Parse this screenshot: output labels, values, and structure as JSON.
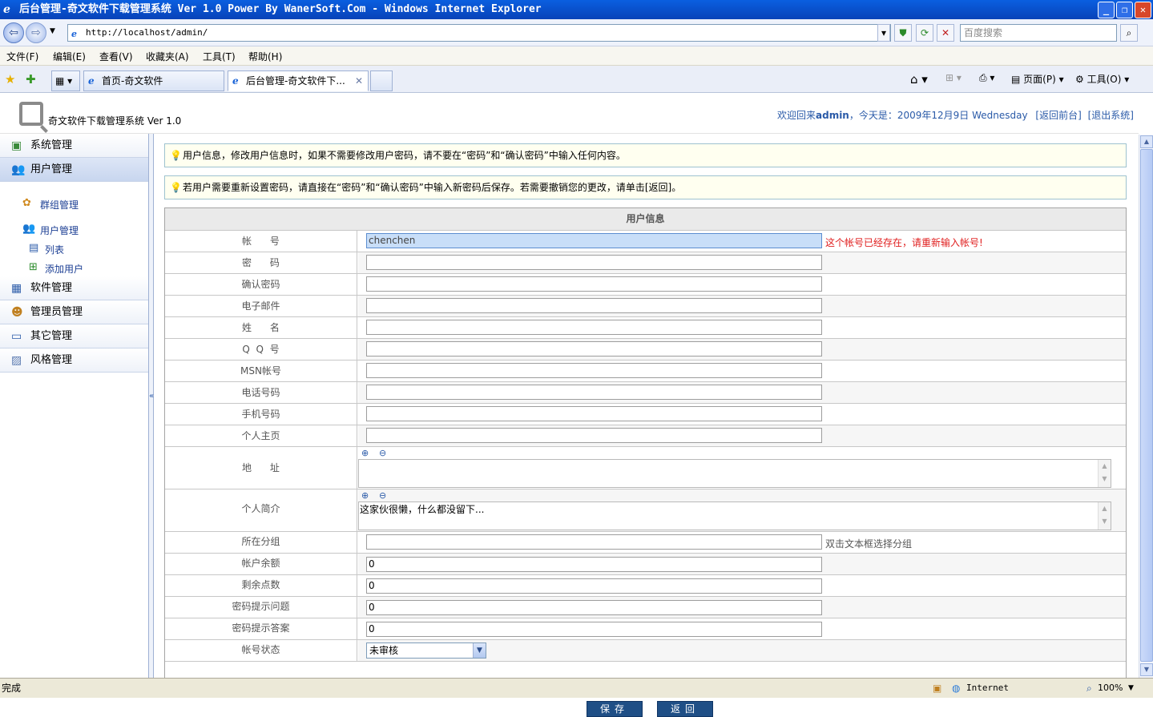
{
  "window": {
    "title": "后台管理-奇文软件下载管理系统 Ver 1.0 Power By WanerSoft.Com - Windows Internet Explorer"
  },
  "browser": {
    "url": "http://localhost/admin/",
    "search_placeholder": "百度搜索",
    "menu": [
      "文件(F)",
      "编辑(E)",
      "查看(V)",
      "收藏夹(A)",
      "工具(T)",
      "帮助(H)"
    ],
    "tabs": [
      {
        "label": "首页-奇文软件",
        "active": false
      },
      {
        "label": "后台管理-奇文软件下...",
        "active": true
      }
    ],
    "commands": {
      "page": "页面(P)",
      "tools": "工具(O)"
    }
  },
  "header": {
    "brand": "奇文软件下载管理系统  Ver 1.0",
    "welcome_prefix": "欢迎回来",
    "user": "admin",
    "date_text": "，今天是：2009年12月9日 Wednesday",
    "back_link": "[返回前台]",
    "logout_link": "[退出系统]"
  },
  "sidebar": {
    "items": [
      {
        "label": "系统管理",
        "icon": "system-icon"
      },
      {
        "label": "用户管理",
        "icon": "users-icon"
      },
      {
        "label": "软件管理",
        "icon": "software-icon"
      },
      {
        "label": "管理员管理",
        "icon": "admin-icon"
      },
      {
        "label": "其它管理",
        "icon": "other-icon"
      },
      {
        "label": "风格管理",
        "icon": "style-icon"
      }
    ],
    "sub": {
      "group": "群组管理",
      "user_mgmt": "用户管理",
      "list": "列表",
      "add_user": "添加用户"
    }
  },
  "notices": [
    "用户信息，修改用户信息时，如果不需要修改用户密码，请不要在“密码”和“确认密码”中输入任何内容。",
    "若用户需要重新设置密码，请直接在“密码”和“确认密码”中输入新密码后保存。若需要撤销您的更改，请单击[返回]。"
  ],
  "form": {
    "title": "用户信息",
    "fields": {
      "account": {
        "label": "帐      号",
        "value": "chenchen",
        "error": "这个帐号已经存在，请重新输入帐号!"
      },
      "password": {
        "label": "密      码",
        "value": ""
      },
      "confirm": {
        "label": "确认密码",
        "value": ""
      },
      "email": {
        "label": "电子邮件",
        "value": ""
      },
      "name": {
        "label": "姓      名",
        "value": ""
      },
      "qq": {
        "label": "Q  Q  号",
        "value": ""
      },
      "msn": {
        "label": "MSN帐号",
        "value": ""
      },
      "phone": {
        "label": "电话号码",
        "value": ""
      },
      "mobile": {
        "label": "手机号码",
        "value": ""
      },
      "homepage": {
        "label": "个人主页",
        "value": ""
      },
      "address": {
        "label": "地      址",
        "value": ""
      },
      "bio": {
        "label": "个人简介",
        "value": "这家伙很懒，什么都没留下..."
      },
      "group": {
        "label": "所在分组",
        "value": "",
        "hint": "双击文本框选择分组"
      },
      "balance": {
        "label": "帐户余额",
        "value": "0"
      },
      "points": {
        "label": "剩余点数",
        "value": "0"
      },
      "question": {
        "label": "密码提示问题",
        "value": "0"
      },
      "answer": {
        "label": "密码提示答案",
        "value": "0"
      },
      "status": {
        "label": "帐号状态",
        "value": "未审核"
      }
    },
    "save_label": "保存",
    "back_label": "返回"
  },
  "status": {
    "text": "完成",
    "zone": "Internet",
    "zoom": "100%"
  }
}
